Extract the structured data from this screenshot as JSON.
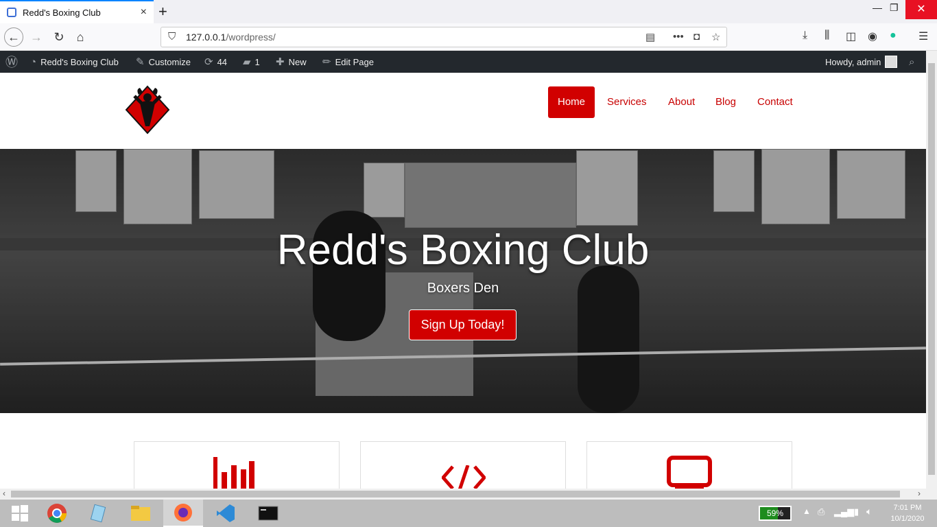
{
  "browser": {
    "tab_title": "Redd's Boxing Club",
    "new_tab": "+",
    "close_tab": "×",
    "url_host": "127.0.0.1",
    "url_path": "/wordpress/"
  },
  "adminbar": {
    "site_name": "Redd's Boxing Club",
    "customize": "Customize",
    "updates_count": "44",
    "comments_count": "1",
    "new": "New",
    "edit_page": "Edit Page",
    "howdy": "Howdy, admin"
  },
  "menu": {
    "items": [
      "Home",
      "Services",
      "About",
      "Blog",
      "Contact"
    ],
    "active": "Home"
  },
  "hero": {
    "title": "Redd's Boxing Club",
    "subtitle": "Boxers Den",
    "cta": "Sign Up Today!"
  },
  "features": [
    {
      "icon": "bar-chart-icon"
    },
    {
      "icon": "code-icon"
    },
    {
      "icon": "laptop-icon"
    }
  ],
  "taskbar": {
    "battery_level": 0.59,
    "battery_label": "59%",
    "time": "7:01 PM",
    "date": "10/1/2020"
  },
  "colors": {
    "brand_red": "#d10000",
    "adminbar_bg": "#23282d",
    "browser_accent": "#0a84ff"
  }
}
